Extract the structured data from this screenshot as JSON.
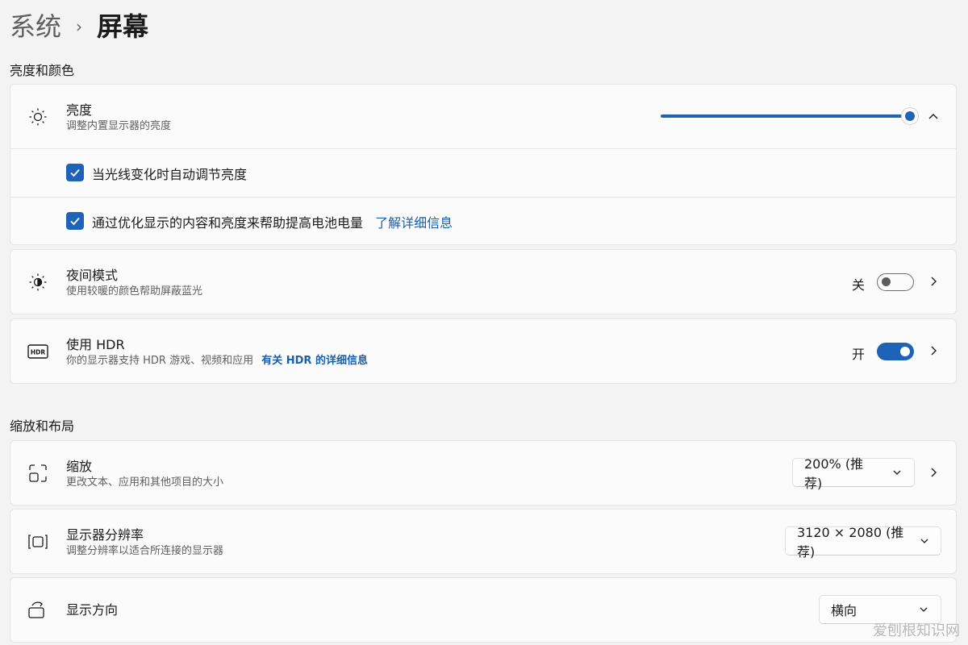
{
  "breadcrumb": {
    "parent": "系统",
    "separator": "›",
    "current": "屏幕"
  },
  "sections": {
    "brightness_color": "亮度和颜色",
    "scale_layout": "缩放和布局"
  },
  "brightness": {
    "title": "亮度",
    "subtitle": "调整内置显示器的亮度",
    "level": 1.0,
    "expanded": true,
    "options": [
      {
        "label": "当光线变化时自动调节亮度",
        "checked": true
      },
      {
        "label": "通过优化显示的内容和亮度来帮助提高电池电量",
        "link": "了解详细信息",
        "checked": true
      }
    ]
  },
  "night_light": {
    "title": "夜间模式",
    "subtitle": "使用较暖的颜色帮助屏蔽蓝光",
    "state_label": "关",
    "on": false
  },
  "hdr": {
    "title": "使用 HDR",
    "subtitle": "你的显示器支持 HDR 游戏、视频和应用",
    "link": "有关 HDR 的详细信息",
    "state_label": "开",
    "on": true
  },
  "scale": {
    "title": "缩放",
    "subtitle": "更改文本、应用和其他项目的大小",
    "value": "200% (推荐)"
  },
  "resolution": {
    "title": "显示器分辨率",
    "subtitle": "调整分辨率以适合所连接的显示器",
    "value": "3120 × 2080 (推荐)"
  },
  "orientation": {
    "title": "显示方向",
    "value": "横向"
  },
  "watermark": "爱刨根知识网",
  "colors": {
    "accent": "#1e63b8",
    "link": "#1a5fa8",
    "background": "#f3f3f3",
    "card": "#fbfbfb"
  }
}
